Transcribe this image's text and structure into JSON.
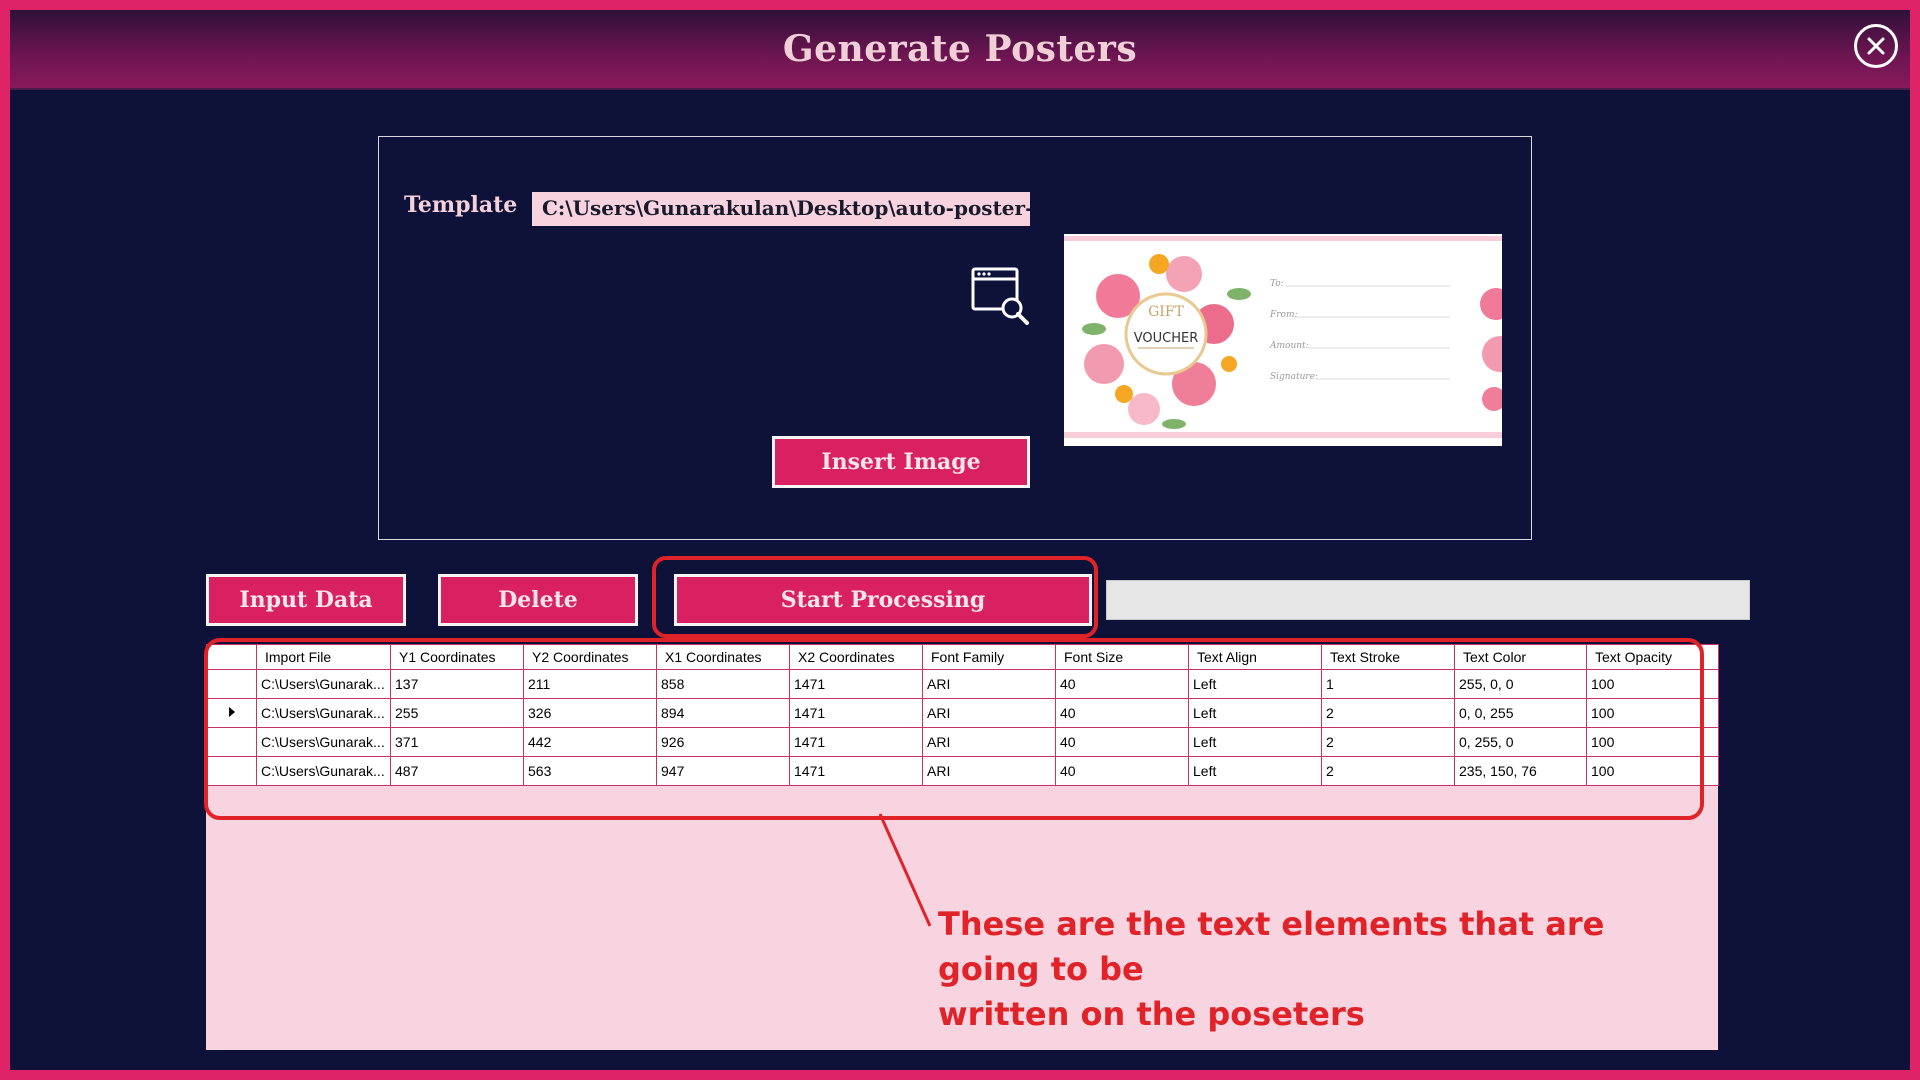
{
  "window": {
    "title": "Generate Posters"
  },
  "template": {
    "label": "Template",
    "path": "C:\\Users\\Gunarakulan\\Desktop\\auto-poster-",
    "browse_icon": "browse-window-search-icon"
  },
  "preview": {
    "gift_text": "GIFT",
    "voucher_text": "VOUCHER",
    "fields": [
      "To:",
      "From:",
      "Amount:",
      "Signature:"
    ]
  },
  "buttons": {
    "insert_image": "Insert Image",
    "input_data": "Input Data",
    "delete": "Delete",
    "start_processing": "Start Processing"
  },
  "progress": {
    "value": 0
  },
  "grid": {
    "columns": [
      "Import File",
      "Y1 Coordinates",
      "Y2 Coordinates",
      "X1 Coordinates",
      "X2 Coordinates",
      "Font Family",
      "Font Size",
      "Text Align",
      "Text Stroke",
      "Text Color",
      "Text Opacity"
    ],
    "rows": [
      [
        "C:\\Users\\Gunarak...",
        "137",
        "211",
        "858",
        "1471",
        "ARI",
        "40",
        "Left",
        "1",
        "255, 0, 0",
        "100"
      ],
      [
        "C:\\Users\\Gunarak...",
        "255",
        "326",
        "894",
        "1471",
        "ARI",
        "40",
        "Left",
        "2",
        "0, 0, 255",
        "100"
      ],
      [
        "C:\\Users\\Gunarak...",
        "371",
        "442",
        "926",
        "1471",
        "ARI",
        "40",
        "Left",
        "2",
        "0, 255, 0",
        "100"
      ],
      [
        "C:\\Users\\Gunarak...",
        "487",
        "563",
        "947",
        "1471",
        "ARI",
        "40",
        "Left",
        "2",
        "235, 150, 76",
        "100"
      ]
    ],
    "current_row": 1
  },
  "annotation": {
    "line1": "These are the text elements that are going to be",
    "line2": "written on the poseters"
  },
  "colors": {
    "accent": "#d92060",
    "frame": "#de2467",
    "background": "#0e1238",
    "annotation": "#e02229"
  }
}
